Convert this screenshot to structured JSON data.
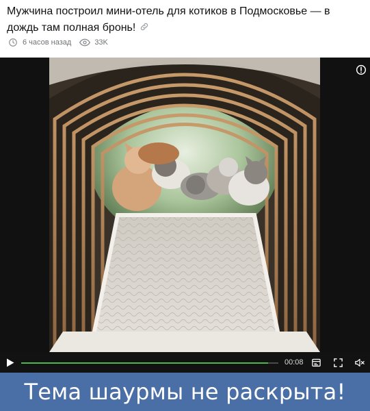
{
  "article": {
    "title": "Мужчина построил мини-отель для котиков в Подмосковье — в дождь там полная бронь!",
    "time_ago": "6 часов назад",
    "views": "33K"
  },
  "icons": {
    "link": "link-icon",
    "clock": "clock-icon",
    "views": "eye-icon",
    "info": "info-icon",
    "play": "play-icon",
    "subtitles": "subtitles-icon",
    "fullscreen": "fullscreen-icon",
    "mute": "speaker-muted-icon"
  },
  "player": {
    "time": "00:08",
    "progress_fraction": 0.96,
    "accent_color": "#4fb84a"
  },
  "caption": {
    "text": "Тема шаурмы не раскрыта!",
    "background": "#4a6fa6"
  }
}
